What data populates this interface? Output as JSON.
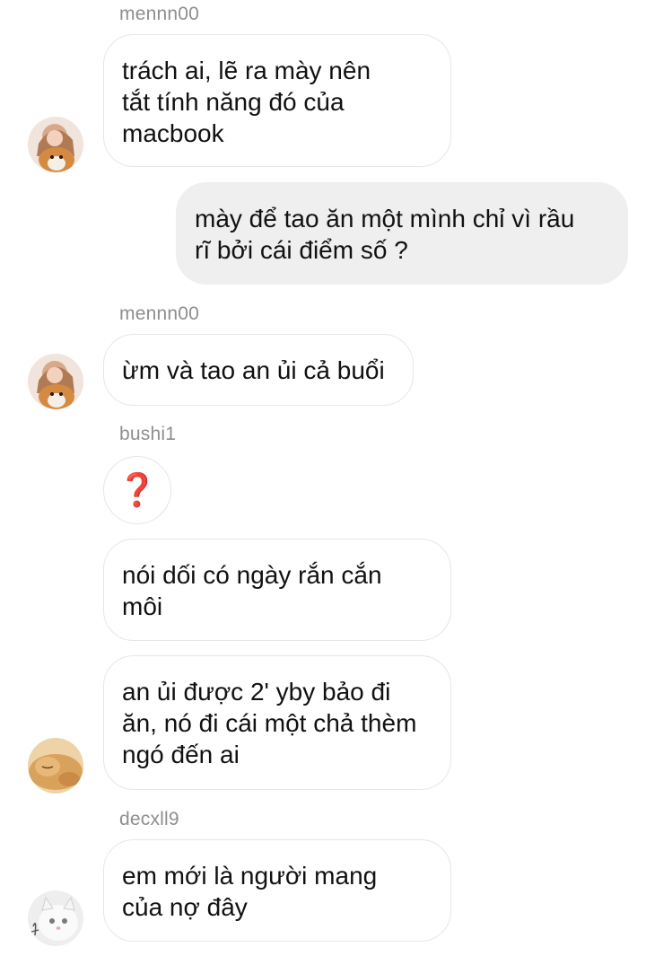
{
  "messages": [
    {
      "sender": "mennn00",
      "text": "trách ai, lẽ ra mày nên\ntắt tính năng đó của\nmacbook"
    },
    {
      "sender": "",
      "text": "mày để tao ăn một mình chỉ vì rầu\nrĩ bởi cái điểm số ?"
    },
    {
      "sender": "mennn00",
      "text": "ừm và tao an ủi cả buổi"
    },
    {
      "sender": "bushi1",
      "text": "❓"
    },
    {
      "sender": "",
      "text": "nói dối có ngày rắn cắn\nmôi"
    },
    {
      "sender": "",
      "text": "an ủi được 2' yby bảo đi\năn, nó đi cái một chả thèm\nngó đến ai"
    },
    {
      "sender": "decxll9",
      "text": "em mới là người mang\ncủa nợ đây"
    }
  ]
}
